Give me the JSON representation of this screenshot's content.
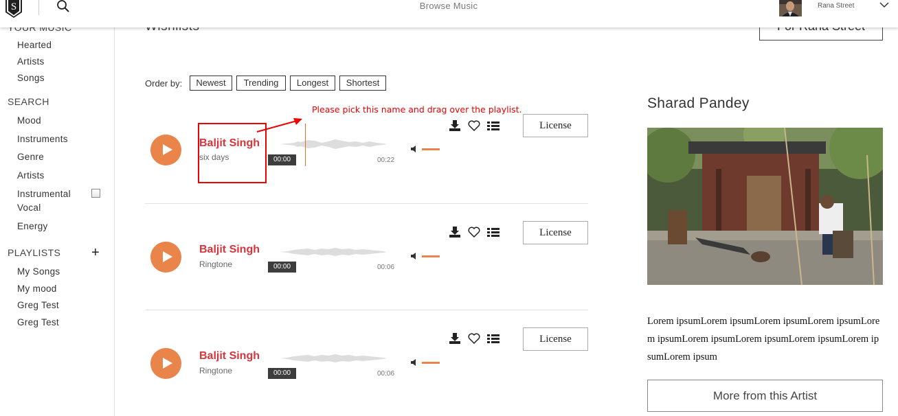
{
  "header": {
    "title": "Browse Music",
    "user_name": "Rana Street",
    "logo_letter": "S"
  },
  "sidebar": {
    "your_music_heading": "YOUR MUSIC",
    "your_music_items": [
      "Hearted",
      "Artists",
      "Songs"
    ],
    "search_heading": "SEARCH",
    "search_items": [
      "Mood",
      "Instruments",
      "Genre",
      "Artists",
      "Instrumental",
      "Vocal",
      "Energy"
    ],
    "playlists_heading": "PLAYLISTS",
    "playlist_items": [
      "My Songs",
      "My mood",
      "Greg Test",
      "Greg Test"
    ]
  },
  "main": {
    "section_title": "Wishlists",
    "for_button": "For Rana Street",
    "order_by_label": "Order by:",
    "order_options": [
      "Newest",
      "Trending",
      "Longest",
      "Shortest"
    ],
    "annotation": "Please pick this name and drag over the playlist.",
    "tracks": [
      {
        "artist": "Baljit Singh",
        "title": "six days",
        "current": "00:00",
        "duration": "00:22",
        "license": "License"
      },
      {
        "artist": "Baljit Singh",
        "title": "Ringtone",
        "current": "00:00",
        "duration": "00:06",
        "license": "License"
      },
      {
        "artist": "Baljit Singh",
        "title": "Ringtone",
        "current": "00:00",
        "duration": "00:06",
        "license": "License"
      }
    ]
  },
  "artist_panel": {
    "name": "Sharad Pandey",
    "bio": "Lorem ipsumLorem ipsumLorem ipsumLorem ipsumLorem ipsumLorem ipsumLorem ipsumLorem ipsumLorem ipsumLorem ipsum",
    "more_button": "More from this Artist"
  },
  "colors": {
    "accent_orange": "#e9844a",
    "artist_red": "#d8343a",
    "annotation_red": "#e00000"
  }
}
